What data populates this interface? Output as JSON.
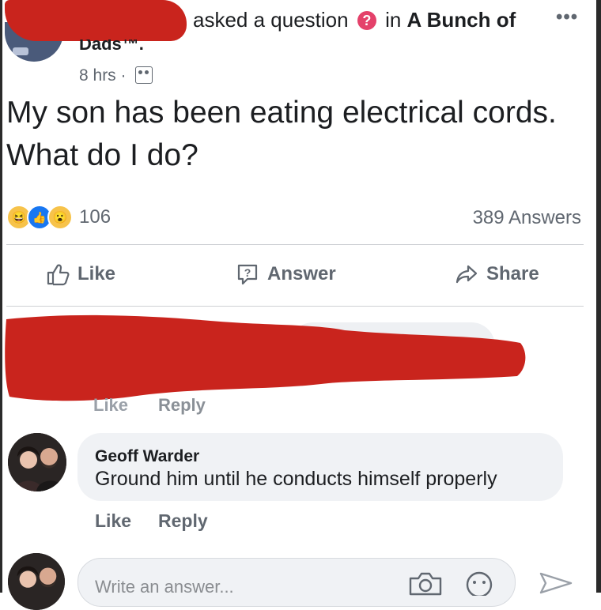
{
  "header": {
    "asked_text": "asked a question",
    "in_text": "in",
    "group_name": "A Bunch of",
    "group_name_tail": "Dads™.",
    "time": "8 hrs",
    "dot": "·",
    "more": "•••"
  },
  "post": {
    "text": "My son has been eating electrical cords. What do I do?"
  },
  "stats": {
    "reaction_count": "106",
    "answers_count": "389 Answers"
  },
  "actions": {
    "like": "Like",
    "answer": "Answer",
    "share": "Share"
  },
  "redacted_comment": {
    "like": "Like",
    "reply": "Reply"
  },
  "comment": {
    "author": "Geoff Warder",
    "text": "Ground him until he conducts himself properly",
    "like": "Like",
    "reply": "Reply"
  },
  "composer": {
    "placeholder": "Write an answer..."
  },
  "colors": {
    "redaction": "#c9241d",
    "question_icon": "#e4416a",
    "like_blue": "#1877f2",
    "bubble": "#f0f2f5"
  }
}
